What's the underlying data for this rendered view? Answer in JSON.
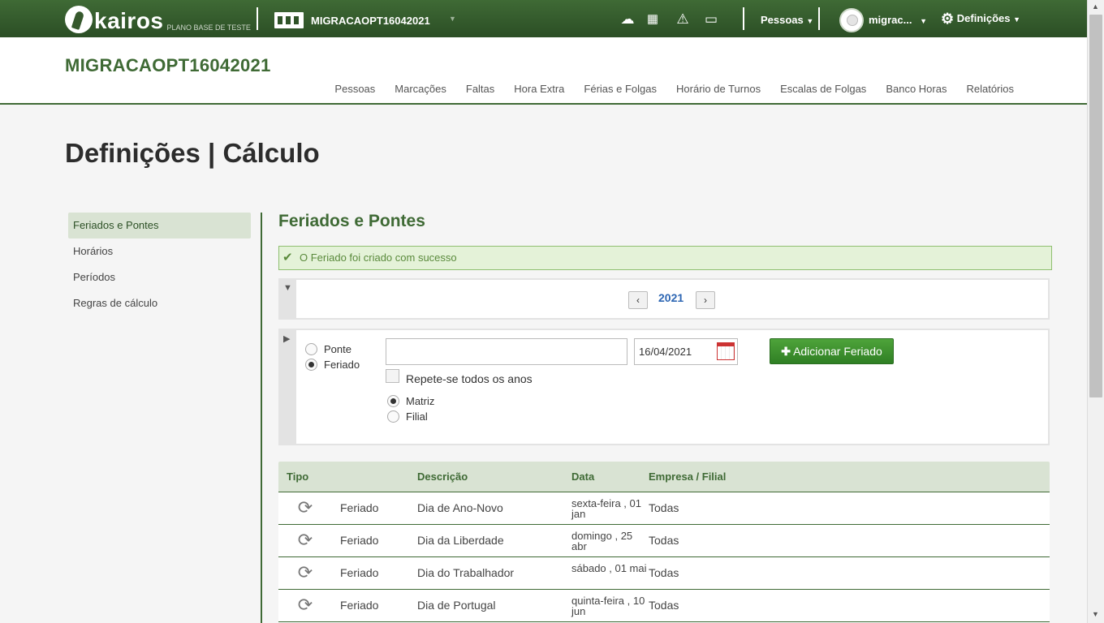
{
  "app": {
    "logo_text": "kairos",
    "logo_sub": "PLANO BASE DE TESTE",
    "company": "MIGRACAOPT16042021",
    "people_menu": "Pessoas",
    "user_name": "migrac...",
    "settings_menu": "Definições"
  },
  "header": {
    "company_title": "MIGRACAOPT16042021",
    "nav": [
      "Pessoas",
      "Marcações",
      "Faltas",
      "Hora Extra",
      "Férias e Folgas",
      "Horário de Turnos",
      "Escalas de Folgas",
      "Banco Horas",
      "Relatórios"
    ]
  },
  "page": {
    "title": "Definições | Cálculo"
  },
  "sidebar": {
    "items": [
      {
        "label": "Feriados e Pontes",
        "active": true
      },
      {
        "label": "Horários"
      },
      {
        "label": "Períodos"
      },
      {
        "label": "Regras de cálculo"
      }
    ]
  },
  "content": {
    "section_title": "Feriados e Pontes",
    "alert": "O Feriado foi criado com sucesso",
    "year": "2021",
    "form": {
      "type_options": [
        "Ponte",
        "Feriado"
      ],
      "type_selected": "Feriado",
      "description_value": "",
      "date_value": "16/04/2021",
      "repeat_label": "Repete-se todos os anos",
      "scope_options": [
        "Matriz",
        "Filial"
      ],
      "scope_selected": "Matriz",
      "add_button": "Adicionar Feriado"
    },
    "table": {
      "headers": [
        "Tipo",
        "Descrição",
        "Data",
        "Empresa / Filial"
      ],
      "rows": [
        {
          "tipo": "Feriado",
          "descricao": "Dia de Ano-Novo",
          "data": "sexta-feira , 01 jan",
          "empresa": "Todas"
        },
        {
          "tipo": "Feriado",
          "descricao": "Dia da Liberdade",
          "data": "domingo , 25 abr",
          "empresa": "Todas"
        },
        {
          "tipo": "Feriado",
          "descricao": "Dia do Trabalhador",
          "data": "sábado , 01 mai",
          "empresa": "Todas"
        },
        {
          "tipo": "Feriado",
          "descricao": "Dia de Portugal",
          "data": "quinta-feira , 10 jun",
          "empresa": "Todas"
        }
      ]
    }
  },
  "colors": {
    "brand": "#3f6a35",
    "accent_button": "#3d8f2e",
    "link_year": "#2d66b3"
  },
  "icons": [
    "cloud-upload-icon",
    "calculator-icon",
    "warning-icon",
    "inbox-icon",
    "gear-icon",
    "filter-icon",
    "play-icon",
    "calendar-icon",
    "recurring-icon",
    "check-icon"
  ]
}
